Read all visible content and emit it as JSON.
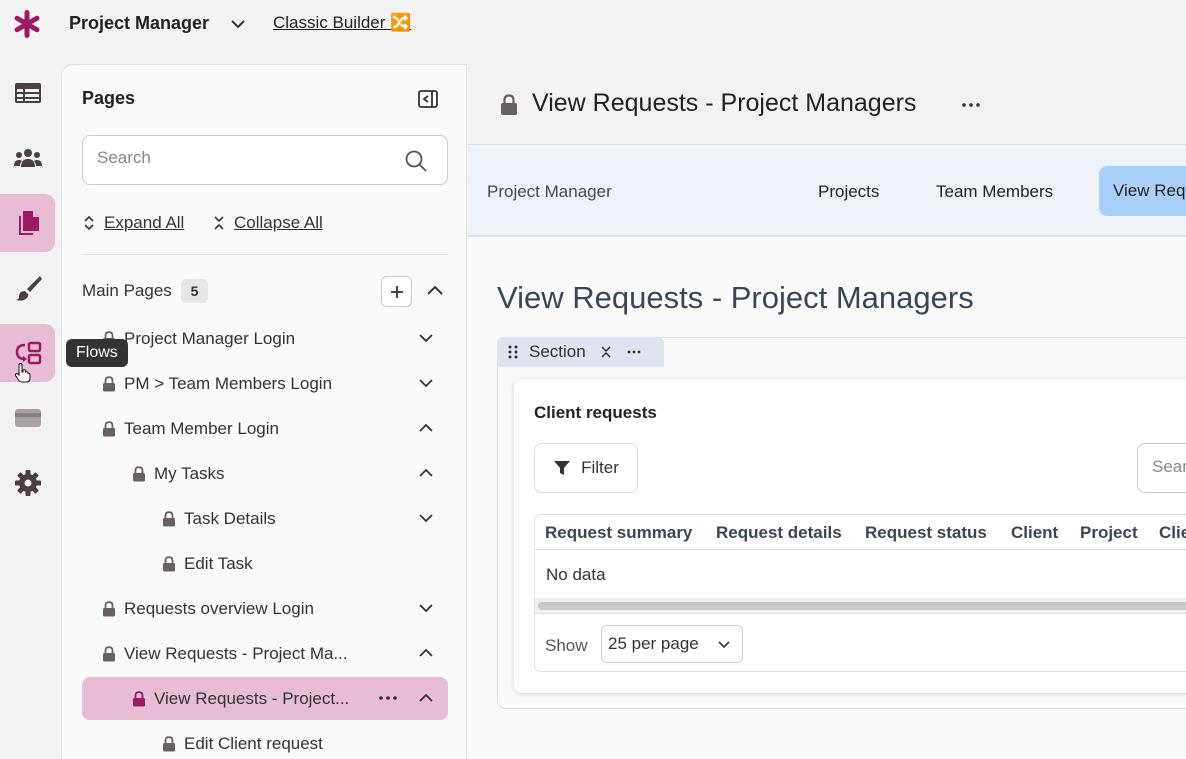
{
  "app": {
    "title": "Project Manager",
    "builder_link": "Classic Builder 🔀",
    "accent_color": "#9b1a64",
    "active_rail_color": "#e8bcd5"
  },
  "rail": {
    "items": [
      {
        "name": "records-icon",
        "active": false
      },
      {
        "name": "users-icon",
        "active": false
      },
      {
        "name": "pages-icon",
        "active": true
      },
      {
        "name": "brush-icon",
        "active": false
      },
      {
        "name": "flows-icon",
        "active": true
      },
      {
        "name": "payments-icon",
        "active": false
      },
      {
        "name": "gear-icon",
        "active": false
      }
    ],
    "tooltip": "Flows"
  },
  "pages_panel": {
    "title": "Pages",
    "search_placeholder": "Search",
    "expand_all": "Expand All",
    "collapse_all": "Collapse All",
    "group_label": "Main Pages",
    "group_count": "5",
    "tree": [
      {
        "label": "Project Manager Login",
        "level": 0,
        "chevron": "down"
      },
      {
        "label": "PM > Team Members Login",
        "level": 0,
        "chevron": "down"
      },
      {
        "label": "Team Member Login",
        "level": 0,
        "chevron": "up"
      },
      {
        "label": "My Tasks",
        "level": 1,
        "chevron": "up"
      },
      {
        "label": "Task Details",
        "level": 2,
        "chevron": "down"
      },
      {
        "label": "Edit Task",
        "level": 2,
        "chevron": ""
      },
      {
        "label": "Requests overview Login",
        "level": 0,
        "chevron": "down"
      },
      {
        "label": "View Requests - Project Ma...",
        "level": 0,
        "chevron": "up"
      },
      {
        "label": "View Requests - Project...",
        "level": 1,
        "chevron": "up",
        "selected": true
      },
      {
        "label": "Edit Client request",
        "level": 2,
        "chevron": ""
      }
    ]
  },
  "main": {
    "header_title": "View Requests - Project Managers",
    "preview": {
      "brand": "Project Manager",
      "nav_links": [
        "Projects",
        "Team Members",
        "View Requests"
      ],
      "page_heading": "View Requests - Project Managers",
      "section_label": "Section",
      "card_title": "Client requests",
      "filter_label": "Filter",
      "table_search_placeholder": "Search",
      "columns": [
        "Request summary",
        "Request details",
        "Request status",
        "Client",
        "Project",
        "Client"
      ],
      "empty_text": "No data",
      "show_label": "Show",
      "per_page": "25 per page"
    }
  }
}
